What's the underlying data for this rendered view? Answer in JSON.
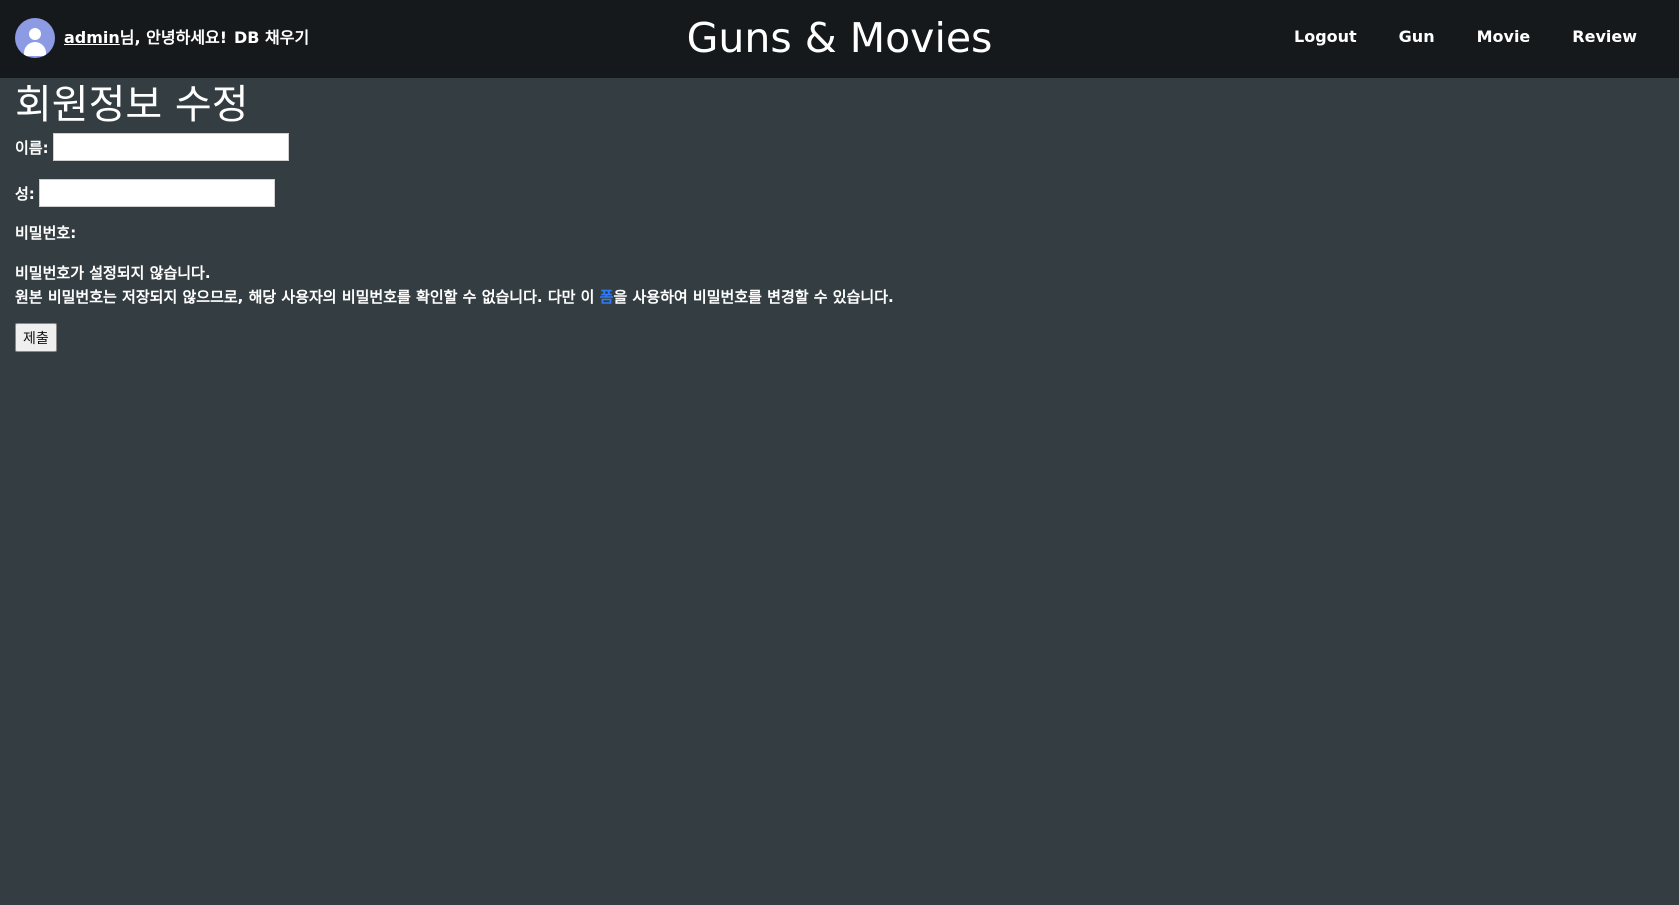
{
  "header": {
    "username": "admin",
    "greeting_suffix": "님, 안녕하세요!",
    "fill_db_link": "DB 채우기",
    "site_title": "Guns & Movies",
    "nav": [
      {
        "label": "Logout"
      },
      {
        "label": "Gun"
      },
      {
        "label": "Movie"
      },
      {
        "label": "Review"
      }
    ]
  },
  "main": {
    "title": "회원정보 수정",
    "form": {
      "first_name_label": "이름:",
      "first_name_value": "",
      "last_name_label": "성:",
      "last_name_value": "",
      "password_label": "비밀번호:",
      "password_status": "비밀번호가 설정되지 않습니다.",
      "password_help_before": "원본 비밀번호는 저장되지 않으므로, 해당 사용자의 비밀번호를 확인할 수 없습니다. 다만 이 ",
      "password_help_link": "폼",
      "password_help_after": "을 사용하여 비밀번호를 변경할 수 있습니다.",
      "submit_label": "제출"
    }
  }
}
